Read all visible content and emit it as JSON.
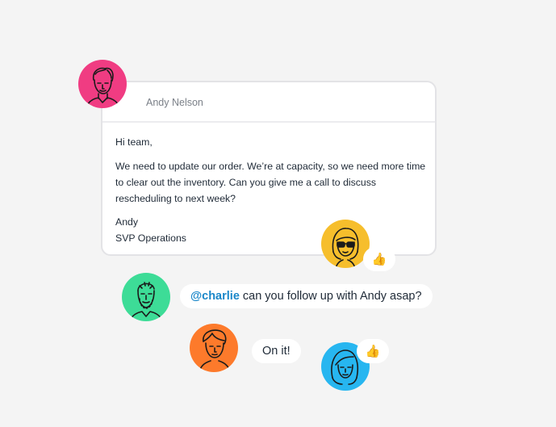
{
  "email": {
    "sender": "Andy Nelson",
    "greeting": "Hi team,",
    "message": "We need to update our order. We’re at capacity, so we need more time to clear out the inventory. Can you give me a call to discuss rescheduling to next week?",
    "signature_name": "Andy",
    "signature_title": "SVP Operations"
  },
  "reactions": [
    {
      "icon": "thumbs-up-icon",
      "glyph": "👍"
    },
    {
      "icon": "thumbs-up-icon",
      "glyph": "👍"
    }
  ],
  "chat": [
    {
      "mention": "@charlie",
      "text": "can you follow up with Andy asap?"
    },
    {
      "text": "On it!"
    }
  ],
  "colors": {
    "avatar_andy": "#f03c82",
    "avatar_yellow": "#f6be2c",
    "avatar_green": "#3ddc97",
    "avatar_orange": "#fd7a2b",
    "avatar_blue": "#27b6f0",
    "mention": "#1a87c9"
  }
}
